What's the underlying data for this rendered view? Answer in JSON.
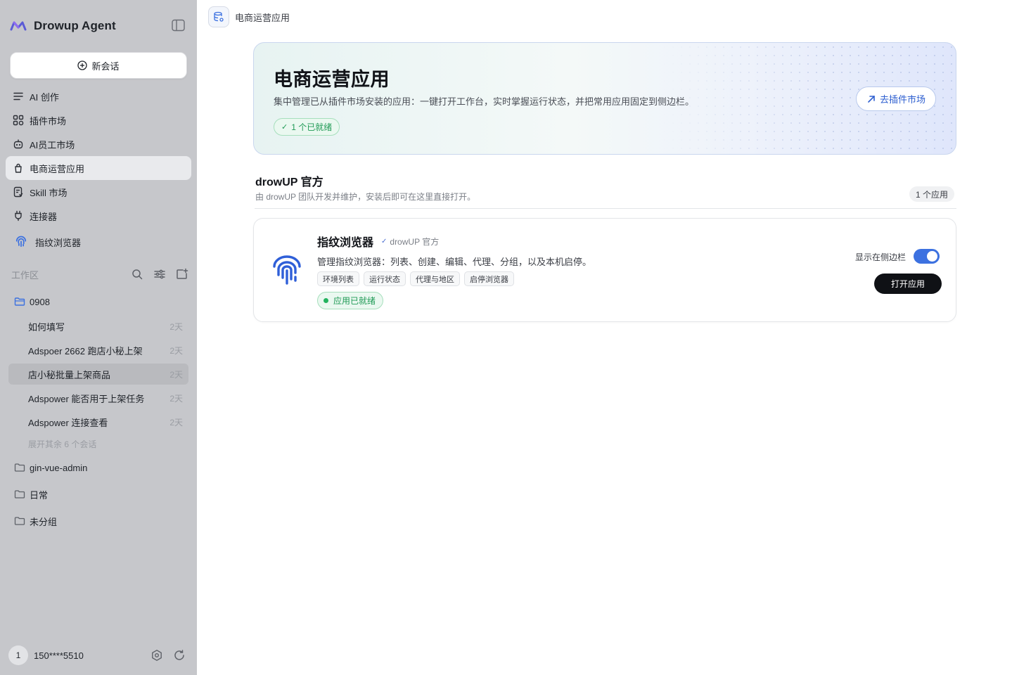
{
  "app": {
    "name": "Drowup Agent",
    "new_chat_label": "新会话"
  },
  "colors": {
    "accent": "#3c71e0",
    "success": "#1f9a55",
    "sidebar_bg": "#c6c7cb",
    "primary_button": "#0f1115"
  },
  "nav": {
    "items": [
      {
        "label": "AI 创作",
        "icon": "lines-icon"
      },
      {
        "label": "插件市场",
        "icon": "grid-icon"
      },
      {
        "label": "AI员工市场",
        "icon": "robot-icon"
      },
      {
        "label": "电商运营应用",
        "icon": "bag-icon",
        "active": true
      },
      {
        "label": "Skill 市场",
        "icon": "skill-icon"
      },
      {
        "label": "连接器",
        "icon": "plug-icon"
      },
      {
        "label": "指纹浏览器",
        "icon": "fingerprint-icon"
      }
    ]
  },
  "workspace": {
    "title": "工作区",
    "folders": [
      {
        "name": "0908",
        "open": true,
        "sessions": [
          {
            "name": "如何填写",
            "age": "2天"
          },
          {
            "name": "Adspoer 2662 跑店小秘上架",
            "age": "2天"
          },
          {
            "name": "店小秘批量上架商品",
            "age": "2天",
            "active": true
          },
          {
            "name": "Adspower 能否用于上架任务",
            "age": "2天"
          },
          {
            "name": "Adspower 连接查看",
            "age": "2天"
          }
        ],
        "expand_label": "展开其余 6 个会话"
      },
      {
        "name": "gin-vue-admin"
      },
      {
        "name": "日常"
      },
      {
        "name": "未分组"
      }
    ]
  },
  "user": {
    "avatar": "1",
    "phone": "150****5510"
  },
  "topbar": {
    "title": "电商运营应用"
  },
  "hero": {
    "title": "电商运营应用",
    "description": "集中管理已从插件市场安装的应用：一键打开工作台，实时掌握运行状态，并把常用应用固定到侧边栏。",
    "badge": "1 个已就绪",
    "button_label": "去插件市场"
  },
  "section": {
    "title": "drowUP 官方",
    "description": "由 drowUP 团队开发并维护，安装后即可在这里直接打开。",
    "count": "1 个应用"
  },
  "apps": [
    {
      "name": "指纹浏览器",
      "publisher": "drowUP 官方",
      "description": "管理指纹浏览器：列表、创建、编辑、代理、分组，以及本机启停。",
      "tags": [
        "环境列表",
        "运行状态",
        "代理与地区",
        "启停浏览器"
      ],
      "status": "应用已就绪",
      "sidebar_toggle_label": "显示在侧边栏",
      "sidebar_toggle_on": true,
      "open_label": "打开应用"
    }
  ]
}
